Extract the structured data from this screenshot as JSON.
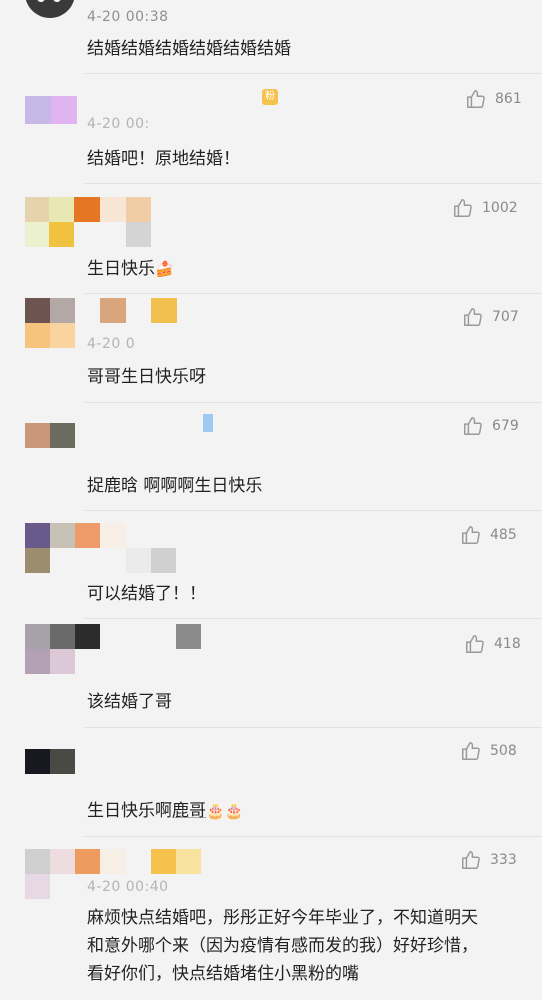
{
  "comments": [
    {
      "timestamp": "4-20 00:38",
      "text": "结婚结婚结婚结婚结婚结婚",
      "likes": ""
    },
    {
      "timestamp": "4-20 00:",
      "badge": "粉",
      "text": "结婚吧！原地结婚！",
      "likes": "861"
    },
    {
      "timestamp": "",
      "text": "生日快乐",
      "text_emoji": "🍰",
      "likes": "1002"
    },
    {
      "timestamp": "4-20 0",
      "text": "哥哥生日快乐呀",
      "likes": "707"
    },
    {
      "timestamp": "",
      "text": "捉鹿晗  啊啊啊生日快乐",
      "likes": "679"
    },
    {
      "timestamp": "",
      "text": "可以结婚了！！",
      "likes": "485"
    },
    {
      "timestamp": "",
      "text": "该结婚了哥",
      "likes": "418"
    },
    {
      "timestamp": "",
      "text_prefix": "生日快乐啊",
      "text_name": "鹿哥",
      "text_emoji": "🎂🎂",
      "likes": "508"
    },
    {
      "timestamp": "4-20 00:40",
      "text_lines": [
        "麻烦快点结婚吧，彤彤正好今年毕业了，不知道明天",
        "和意外哪个来（因为疫情有感而发的我）好好珍惜，",
        "看好你们，快点结婚堵住小黑粉的嘴"
      ],
      "likes": "333"
    }
  ],
  "icons": {
    "like": "thumbs-up-icon",
    "cake": "cake-emoji",
    "birthday": "birthday-cake-emoji"
  },
  "colors": {
    "background": "#f3f3f3",
    "text": "#222222",
    "meta": "#8f8f8f",
    "badge": "#f5c24b"
  }
}
